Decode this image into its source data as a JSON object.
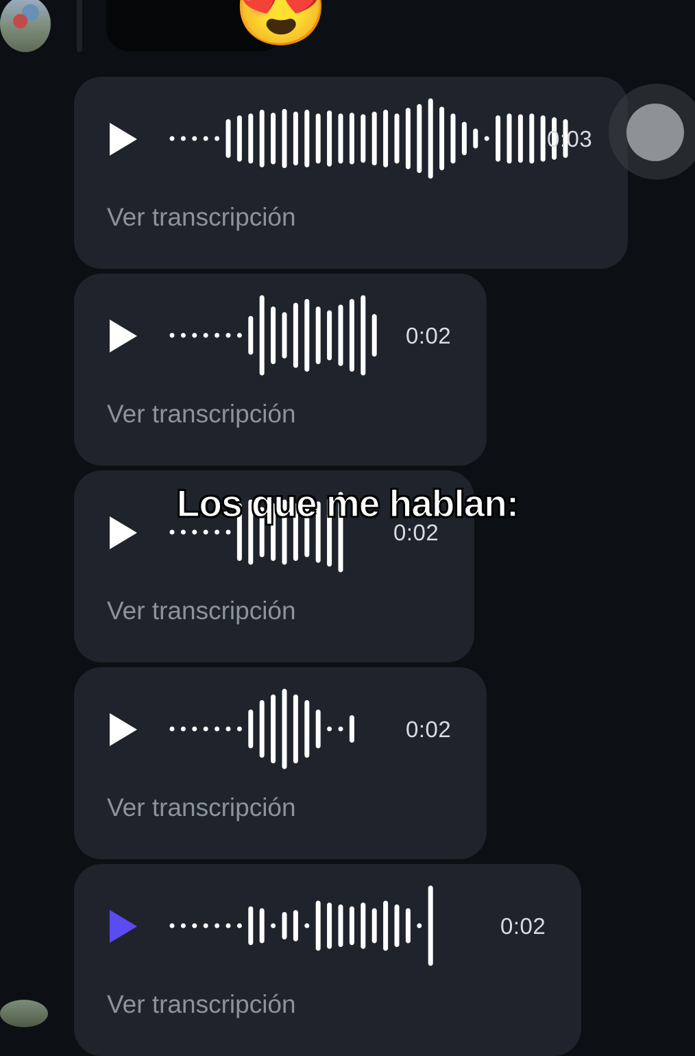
{
  "icons": {
    "play": "play-icon",
    "emoji": "heart-eyes-emoji"
  },
  "colors": {
    "background": "#0c1014",
    "bubble": "#1f242c",
    "accent_play": "#5b4bf2",
    "transcript_text": "#8c939c"
  },
  "top_emoji": "😍",
  "voice_messages": [
    {
      "duration": "0:03",
      "transcript_label": "Ver transcripción",
      "playing": false
    },
    {
      "duration": "0:02",
      "transcript_label": "Ver transcripción",
      "playing": false
    },
    {
      "duration": "0:02",
      "transcript_label": "Ver transcripción",
      "playing": false
    },
    {
      "duration": "0:02",
      "transcript_label": "Ver transcripción",
      "playing": false
    },
    {
      "duration": "0:02",
      "transcript_label": "Ver transcripción",
      "playing": true
    }
  ],
  "overlay_caption": "Los que me hablan:"
}
